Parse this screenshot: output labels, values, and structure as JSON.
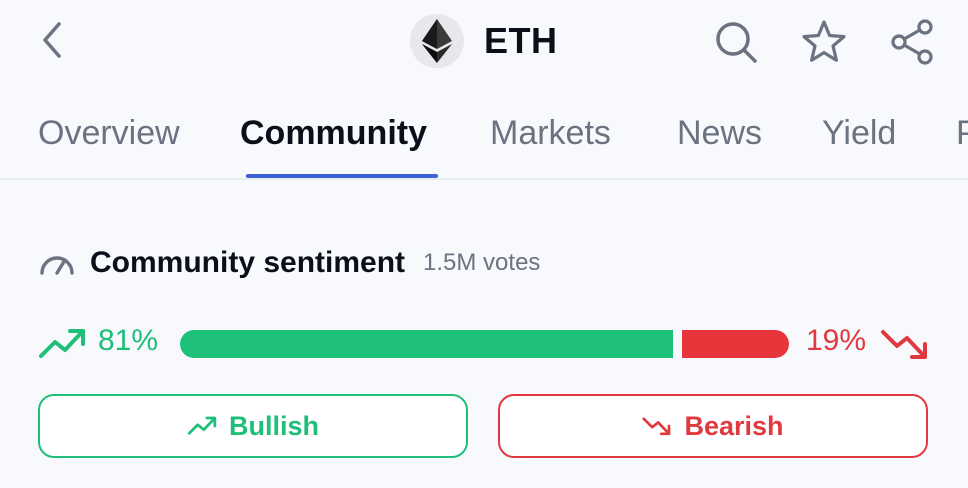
{
  "header": {
    "coin_symbol": "ETH",
    "icons": [
      "back-chevron-icon",
      "ethereum-logo-icon",
      "search-icon",
      "star-icon",
      "share-icon"
    ]
  },
  "tabs": [
    {
      "label": "Overview",
      "active": false
    },
    {
      "label": "Community",
      "active": true
    },
    {
      "label": "Markets",
      "active": false
    },
    {
      "label": "News",
      "active": false
    },
    {
      "label": "Yield",
      "active": false
    },
    {
      "label": "P",
      "active": false
    }
  ],
  "sentiment": {
    "title": "Community sentiment",
    "votes": "1.5M votes",
    "bullish_pct": "81%",
    "bearish_pct": "19%",
    "bullish_value": 0.81,
    "bearish_value": 0.19
  },
  "buttons": {
    "bullish_label": "Bullish",
    "bearish_label": "Bearish"
  },
  "colors": {
    "bullish": "#1fbf7a",
    "bearish": "#e03a40",
    "accent": "#3c63d8"
  }
}
